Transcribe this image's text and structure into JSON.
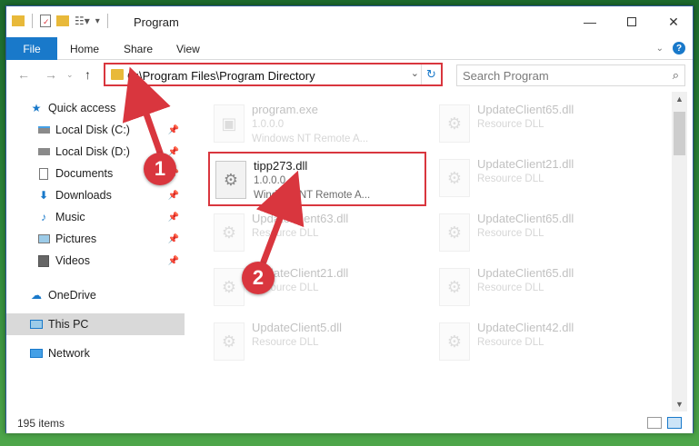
{
  "window": {
    "title": "Program"
  },
  "ribbon": {
    "file": "File",
    "home": "Home",
    "share": "Share",
    "view": "View"
  },
  "address": {
    "path": "C:\\Program Files\\Program Directory"
  },
  "search": {
    "placeholder": "Search Program"
  },
  "nav": {
    "quick_access": "Quick access",
    "items": [
      {
        "label": "Local Disk (C:)",
        "icon": "drive-icon",
        "pinned": true
      },
      {
        "label": "Local Disk (D:)",
        "icon": "drive-icon",
        "pinned": true
      },
      {
        "label": "Documents",
        "icon": "documents-icon",
        "pinned": true
      },
      {
        "label": "Downloads",
        "icon": "downloads-icon",
        "pinned": true
      },
      {
        "label": "Music",
        "icon": "music-icon",
        "pinned": true
      },
      {
        "label": "Pictures",
        "icon": "pictures-icon",
        "pinned": true
      },
      {
        "label": "Videos",
        "icon": "videos-icon",
        "pinned": true
      }
    ],
    "onedrive": "OneDrive",
    "this_pc": "This PC",
    "network": "Network"
  },
  "files": [
    {
      "name": "program.exe",
      "version": "1.0.0.0",
      "desc": "Windows NT Remote A..."
    },
    {
      "name": "UpdateClient65.dll",
      "version": "Resource DLL",
      "desc": ""
    },
    {
      "name": "tipp273.dll",
      "version": "1.0.0.0",
      "desc": "Windows NT Remote A..."
    },
    {
      "name": "UpdateClient21.dll",
      "version": "Resource DLL",
      "desc": ""
    },
    {
      "name": "UpdateClient63.dll",
      "version": "Resource DLL",
      "desc": ""
    },
    {
      "name": "UpdateClient65.dll",
      "version": "Resource DLL",
      "desc": ""
    },
    {
      "name": "UpdateClient21.dll",
      "version": "Resource DLL",
      "desc": ""
    },
    {
      "name": "UpdateClient65.dll",
      "version": "Resource DLL",
      "desc": ""
    },
    {
      "name": "UpdateClient5.dll",
      "version": "Resource DLL",
      "desc": ""
    },
    {
      "name": "UpdateClient42.dll",
      "version": "Resource DLL",
      "desc": ""
    }
  ],
  "status": {
    "count": "195 items"
  },
  "annotations": {
    "step1": "1",
    "step2": "2"
  },
  "colors": {
    "accent": "#1979ca",
    "highlight": "#d9363e"
  }
}
